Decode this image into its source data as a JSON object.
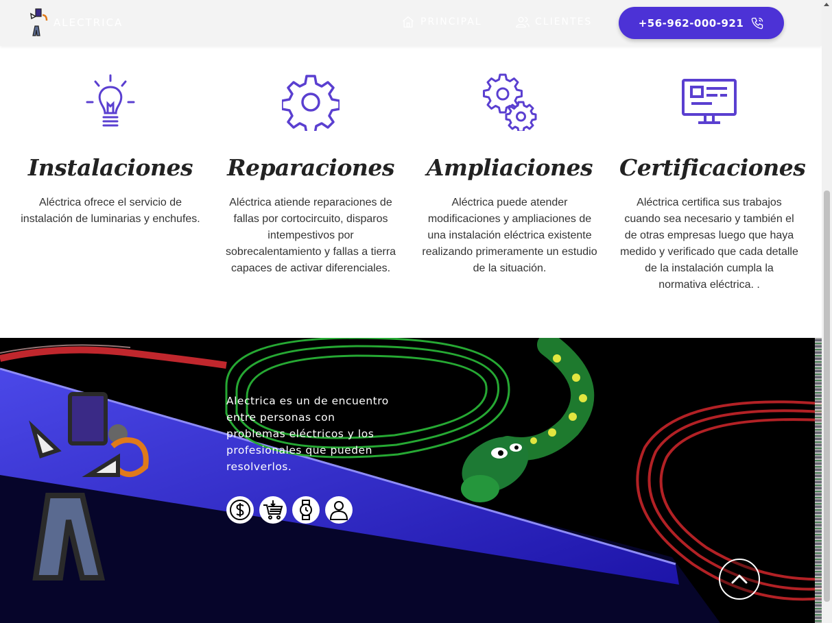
{
  "nav": {
    "brand": "ALECTRICA",
    "links": [
      {
        "label": "PRINCIPAL",
        "icon": "home-icon"
      },
      {
        "label": "CLIENTES",
        "icon": "users-icon"
      }
    ],
    "phone": "+56-962-000-921",
    "phone_icon": "phone-icon"
  },
  "services": [
    {
      "title": "Instalaciones",
      "icon": "lightbulb-icon",
      "text": "Aléctrica ofrece el servicio de instalación de luminarias y enchufes."
    },
    {
      "title": "Reparaciones",
      "icon": "gear-icon",
      "text": "Aléctrica atiende reparaciones de fallas por cortocircuito, disparos intempestivos por sobrecalentamiento y fallas a tierra capaces de activar diferenciales."
    },
    {
      "title": "Ampliaciones",
      "icon": "gears-icon",
      "text": "Aléctrica puede atender modificaciones y ampliaciones de una instalación eléctrica existente realizando primeramente un estudio de la situación."
    },
    {
      "title": "Certificaciones",
      "icon": "monitor-dashboard-icon",
      "text": "Aléctrica certifica sus trabajos cuando sea necesario y también el de otras empresas luego que haya medido y verificado que cada detalle de la instalación cumpla la normativa eléctrica. ."
    }
  ],
  "footer": {
    "about": "Alectrica es un  de encuentro entre personas con problemas eléctricos y los profesionales que pueden resolverlos.",
    "social_icons": [
      "dollar-icon",
      "cart-icon",
      "watch-icon",
      "user-icon"
    ]
  },
  "colors": {
    "accent": "#4c32d6",
    "icon": "#5a3fd0",
    "navbar": "#f3f3f3",
    "footer": "#000000"
  }
}
